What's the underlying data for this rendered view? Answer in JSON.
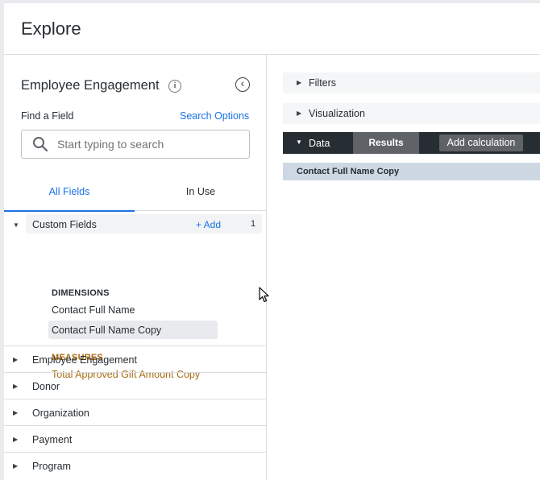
{
  "header": {
    "title": "Explore"
  },
  "sidebar": {
    "model_title": "Employee Engagement",
    "find_label": "Find a Field",
    "search_options": "Search Options",
    "search": {
      "placeholder": "Start typing to search",
      "value": ""
    },
    "tabs": [
      {
        "label": "All Fields"
      },
      {
        "label": "In Use"
      }
    ],
    "custom_fields": {
      "label": "Custom Fields",
      "add_label": "+ Add",
      "count": "1",
      "dimensions_label": "DIMENSIONS",
      "dimensions": [
        "Contact Full Name",
        "Contact Full Name Copy"
      ],
      "measures_label": "MEASURES",
      "measures": [
        "Total Approved Gift Amount Copy"
      ]
    },
    "views": [
      "Employee Engagement",
      "Donor",
      "Organization",
      "Payment",
      "Program"
    ]
  },
  "main": {
    "filters_label": "Filters",
    "visualization_label": "Visualization",
    "data_label": "Data",
    "results_label": "Results",
    "add_calculation_label": "Add calculation",
    "columns": [
      "Contact Full Name Copy"
    ]
  },
  "colors": {
    "accent": "#1a73e8",
    "measure": "#a76b13",
    "dark_bar": "#262d33",
    "results_header": "#cdd8e3"
  }
}
